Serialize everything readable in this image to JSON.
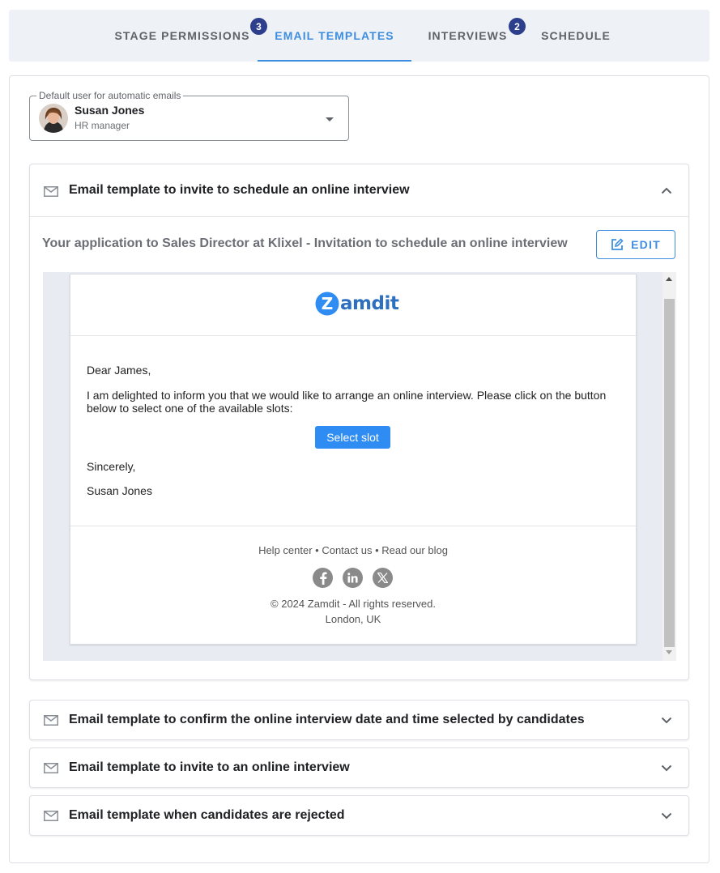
{
  "tabs": [
    {
      "label": "STAGE PERMISSIONS",
      "badge": "3",
      "active": false
    },
    {
      "label": "EMAIL TEMPLATES",
      "badge": "",
      "active": true
    },
    {
      "label": "INTERVIEWS",
      "badge": "2",
      "active": false
    },
    {
      "label": "SCHEDULE",
      "badge": "",
      "active": false
    }
  ],
  "default_user": {
    "label": "Default user for automatic emails",
    "name": "Susan Jones",
    "role": "HR manager"
  },
  "accordions": [
    {
      "title": "Email template to invite to schedule an online interview",
      "expanded": true
    },
    {
      "title": "Email template to confirm the online interview date and time selected by candidates",
      "expanded": false
    },
    {
      "title": "Email template to invite to an online interview",
      "expanded": false
    },
    {
      "title": "Email template when candidates are rejected",
      "expanded": false
    }
  ],
  "template": {
    "subject": "Your application to Sales Director at Klixel - Invitation to schedule an online interview",
    "edit_label": "EDIT",
    "email": {
      "logo_text": "amdit",
      "logo_letter": "Z",
      "greeting": "Dear James,",
      "body_line1": "I am delighted to inform you that we would like to arrange an online interview. Please click on the button",
      "body_line2": "below to select one of the available slots:",
      "button_label": "Select slot",
      "closing": "Sincerely,",
      "signature": "Susan Jones",
      "footer_links": [
        "Help center",
        "Contact us",
        "Read our blog"
      ],
      "footer_separator": " • ",
      "copyright": "© 2024 Zamdit - All rights reserved.",
      "location": "London, UK"
    }
  },
  "colors": {
    "accent": "#3d8ee0",
    "badge": "#2c3e8c",
    "brand": "#2e6fbf",
    "button": "#2f8cf2"
  }
}
